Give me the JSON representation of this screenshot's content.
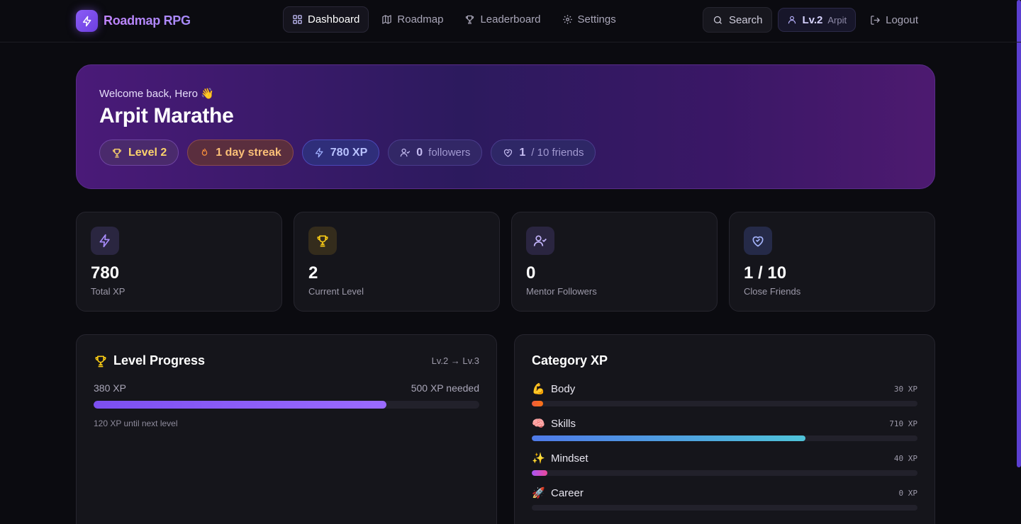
{
  "nav": {
    "brand": "Roadmap RPG",
    "links": [
      {
        "label": "Dashboard",
        "icon": "grid-icon",
        "active": true
      },
      {
        "label": "Roadmap",
        "icon": "map-icon"
      },
      {
        "label": "Leaderboard",
        "icon": "trophy-icon"
      },
      {
        "label": "Settings",
        "icon": "gear-icon"
      }
    ],
    "search_label": "Search",
    "user_level": "Lv.2",
    "user_name": "Arpit",
    "logout_label": "Logout"
  },
  "hero": {
    "welcome": "Welcome back, Hero 👋",
    "name": "Arpit Marathe",
    "badges": {
      "level": "Level 2",
      "streak": "1 day streak",
      "xp": "780 XP",
      "followers_count": "0",
      "followers_label": "followers",
      "friends_count": "1",
      "friends_label": "/ 10 friends"
    }
  },
  "stats": [
    {
      "value": "780",
      "label": "Total XP",
      "icon": "bolt-icon"
    },
    {
      "value": "2",
      "label": "Current Level",
      "icon": "trophy-icon"
    },
    {
      "value": "0",
      "label": "Mentor Followers",
      "icon": "user-check-icon"
    },
    {
      "value": "1 / 10",
      "label": "Close Friends",
      "icon": "heart-handshake-icon"
    }
  ],
  "level_progress": {
    "title": "Level Progress",
    "range": "Lv.2 → Lv.3",
    "current": "380 XP",
    "needed": "500 XP needed",
    "progress_fraction": 0.76,
    "note": "120 XP until next level"
  },
  "category_xp": {
    "title": "Category XP",
    "items": [
      {
        "emoji": "💪",
        "name": "Body",
        "xp": "30 XP",
        "fraction": 0.03,
        "color": "#ef5a3c"
      },
      {
        "emoji": "🧠",
        "name": "Skills",
        "xp": "710 XP",
        "fraction": 0.71,
        "color": "#4f8be8"
      },
      {
        "emoji": "✨",
        "name": "Mindset",
        "xp": "40 XP",
        "fraction": 0.04,
        "color": "#c04fd6"
      },
      {
        "emoji": "🚀",
        "name": "Career",
        "xp": "0 XP",
        "fraction": 0.0,
        "color": "#f59e0b"
      }
    ]
  },
  "colors": {
    "accent": "#8b5cf6",
    "background": "#0b0b10"
  }
}
